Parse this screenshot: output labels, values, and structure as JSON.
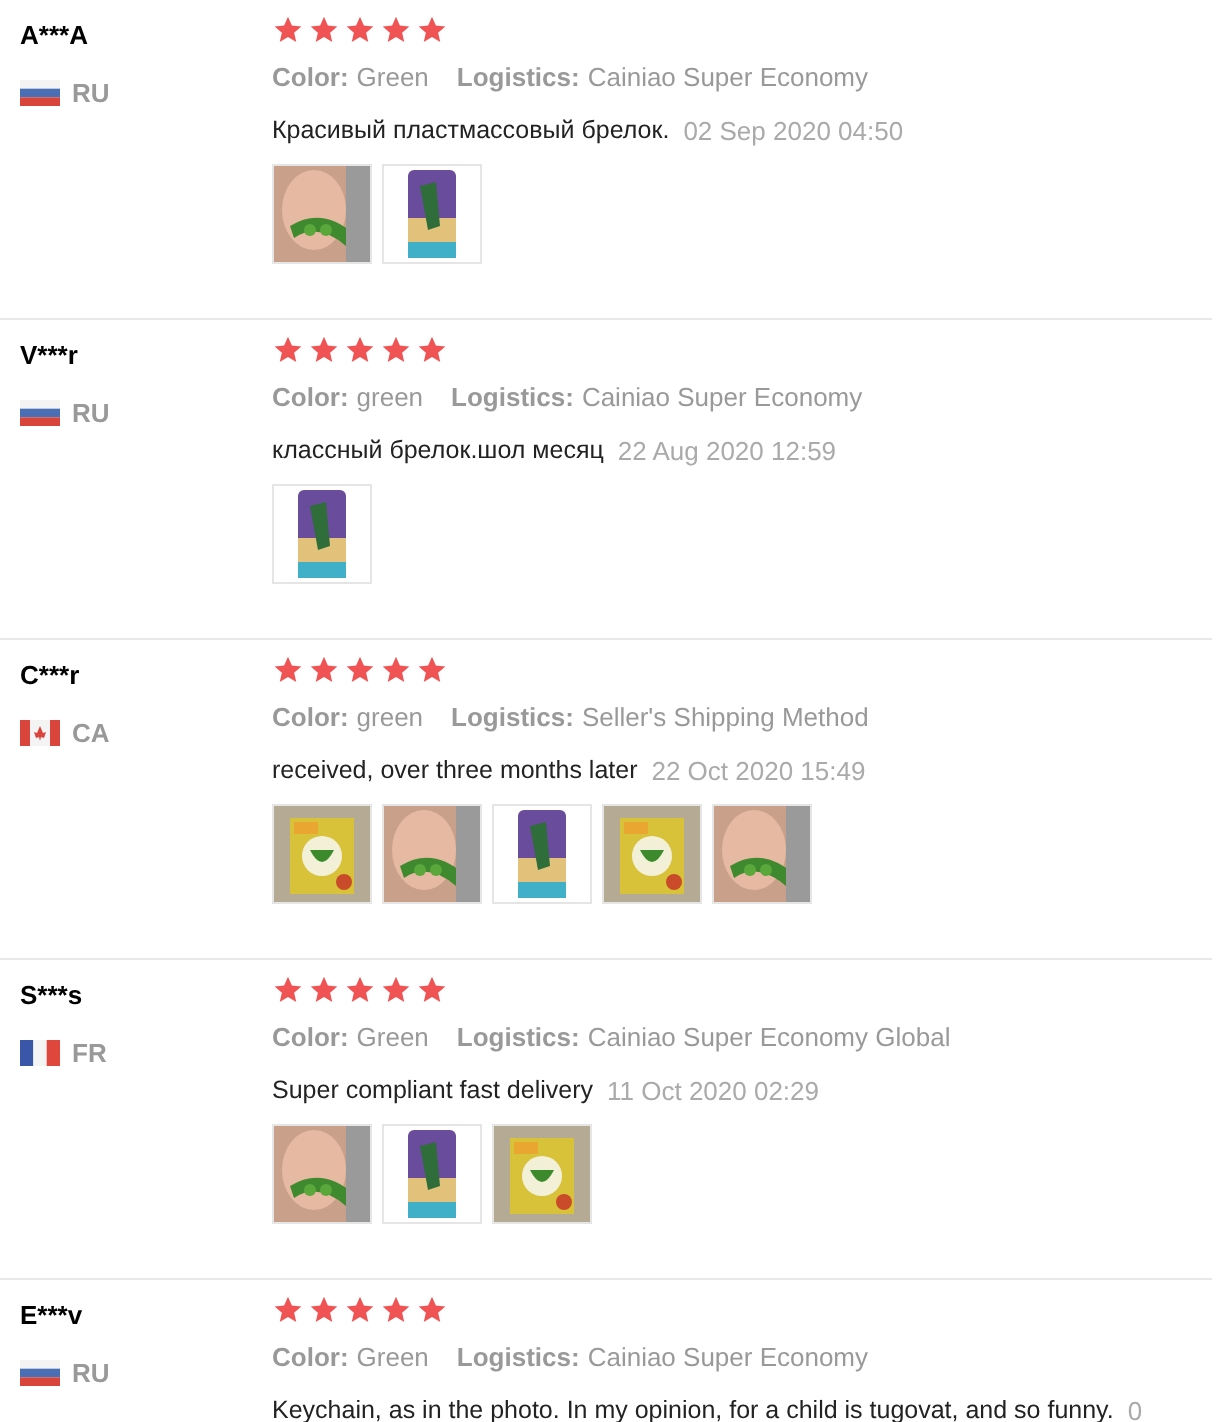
{
  "reviews": [
    {
      "user": "A***A",
      "flag": {
        "kind": "ru"
      },
      "country": "RU",
      "stars": 5,
      "color_label": "Color:",
      "color_value": "Green",
      "logistics_label": "Logistics:",
      "logistics": "Cainiao Super Economy",
      "text": "Красивый пластмассовый брелок.",
      "date": "02 Sep 2020 04:50",
      "photos": [
        {
          "kind": "picture"
        },
        {
          "kind": "picture"
        }
      ]
    },
    {
      "user": "V***r",
      "flag": {
        "kind": "ru"
      },
      "country": "RU",
      "stars": 5,
      "color_label": "Color:",
      "color_value": "green",
      "logistics_label": "Logistics:",
      "logistics": "Cainiao Super Economy",
      "text": "классный брелок.шол месяц",
      "date": "22 Aug 2020 12:59",
      "photos": [
        {
          "kind": "picture"
        }
      ]
    },
    {
      "user": "C***r",
      "flag": {
        "kind": "ca"
      },
      "country": "CA",
      "stars": 5,
      "color_label": "Color:",
      "color_value": "green",
      "logistics_label": "Logistics:",
      "logistics": "Seller's Shipping Method",
      "text": "received, over three months later",
      "date": "22 Oct 2020 15:49",
      "photos": [
        {
          "kind": "picture"
        },
        {
          "kind": "picture"
        },
        {
          "kind": "picture"
        },
        {
          "kind": "picture"
        },
        {
          "kind": "picture"
        }
      ]
    },
    {
      "user": "S***s",
      "flag": {
        "kind": "fr"
      },
      "country": "FR",
      "stars": 5,
      "color_label": "Color:",
      "color_value": "Green",
      "logistics_label": "Logistics:",
      "logistics": "Cainiao Super Economy Global",
      "text": "Super compliant fast delivery",
      "date": "11 Oct 2020 02:29",
      "photos": [
        {
          "kind": "picture"
        },
        {
          "kind": "picture"
        },
        {
          "kind": "picture"
        }
      ]
    },
    {
      "user": "E***v",
      "flag": {
        "kind": "ru"
      },
      "country": "RU",
      "stars": 5,
      "color_label": "Color:",
      "color_value": "Green",
      "logistics_label": "Logistics:",
      "logistics": "Cainiao Super Economy",
      "text": "Keychain, as in the photo. In my opinion, for a child is tugovat, and so funny.",
      "date": "0"
    }
  ]
}
